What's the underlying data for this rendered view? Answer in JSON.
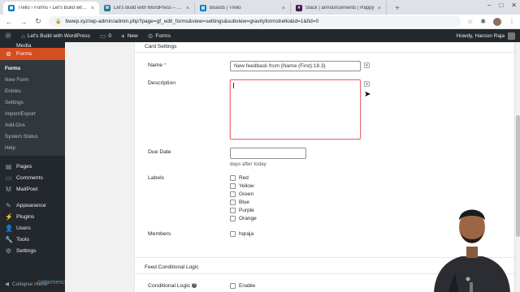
{
  "browser": {
    "tabs": [
      {
        "title": "Trello › Forms ‹ Let's Build with W",
        "favicon": "trello-wp-icon",
        "color": "#0079bf",
        "active": true
      },
      {
        "title": "Let's Build with WordPress – A W",
        "favicon": "wordpress-icon",
        "color": "#21759b",
        "active": false
      },
      {
        "title": "Boards | Trello",
        "favicon": "trello-icon",
        "color": "#0079bf",
        "active": false
      },
      {
        "title": "Slack | announcements | Happy",
        "favicon": "slack-icon",
        "color": "#4a154b",
        "active": false
      }
    ],
    "url": "bwwp.xyz/wp-admin/admin.php?page=gf_edit_forms&view=settings&subview=gravityformstrello&id=1&fid=0"
  },
  "adminbar": {
    "site_name": "Let's Build with WordPress",
    "comments_count": "0",
    "new_label": "New",
    "forms_label": "Forms",
    "greeting": "Howdy, Haroon Raja"
  },
  "sidebar": {
    "media_label": "Media",
    "forms_label": "Forms",
    "submenu": [
      "Forms",
      "New Form",
      "Entries",
      "Settings",
      "Import/Export",
      "Add-Ons",
      "System Status",
      "Help"
    ],
    "items": [
      {
        "label": "Pages",
        "icon": "pages-icon"
      },
      {
        "label": "Comments",
        "icon": "comments-icon"
      },
      {
        "label": "MailPoet",
        "icon": "mailpoet-icon"
      },
      {
        "label": "Appearance",
        "icon": "appearance-icon"
      },
      {
        "label": "Plugins",
        "icon": "plugins-icon"
      },
      {
        "label": "Users",
        "icon": "users-icon"
      },
      {
        "label": "Tools",
        "icon": "tools-icon"
      },
      {
        "label": "Settings",
        "icon": "settings-icon"
      }
    ],
    "collapse_label": "Collapse menu",
    "watermark": "collarmence"
  },
  "card": {
    "section_title": "Card Settings",
    "name_label": "Name",
    "name_required": "*",
    "name_value": "New feedback from {Name (First):18.3}",
    "description_label": "Description",
    "description_value": "",
    "due_date_label": "Due Date",
    "due_date_value": "",
    "due_date_help": "days after today",
    "labels_label": "Labels",
    "labels": [
      "Red",
      "Yellow",
      "Green",
      "Blue",
      "Purple",
      "Orange"
    ],
    "members_label": "Members",
    "members": [
      "hqraja"
    ]
  },
  "conditional": {
    "section_title": "Feed Conditional Logic",
    "label": "Conditional Logic",
    "enable_label": "Enable"
  }
}
